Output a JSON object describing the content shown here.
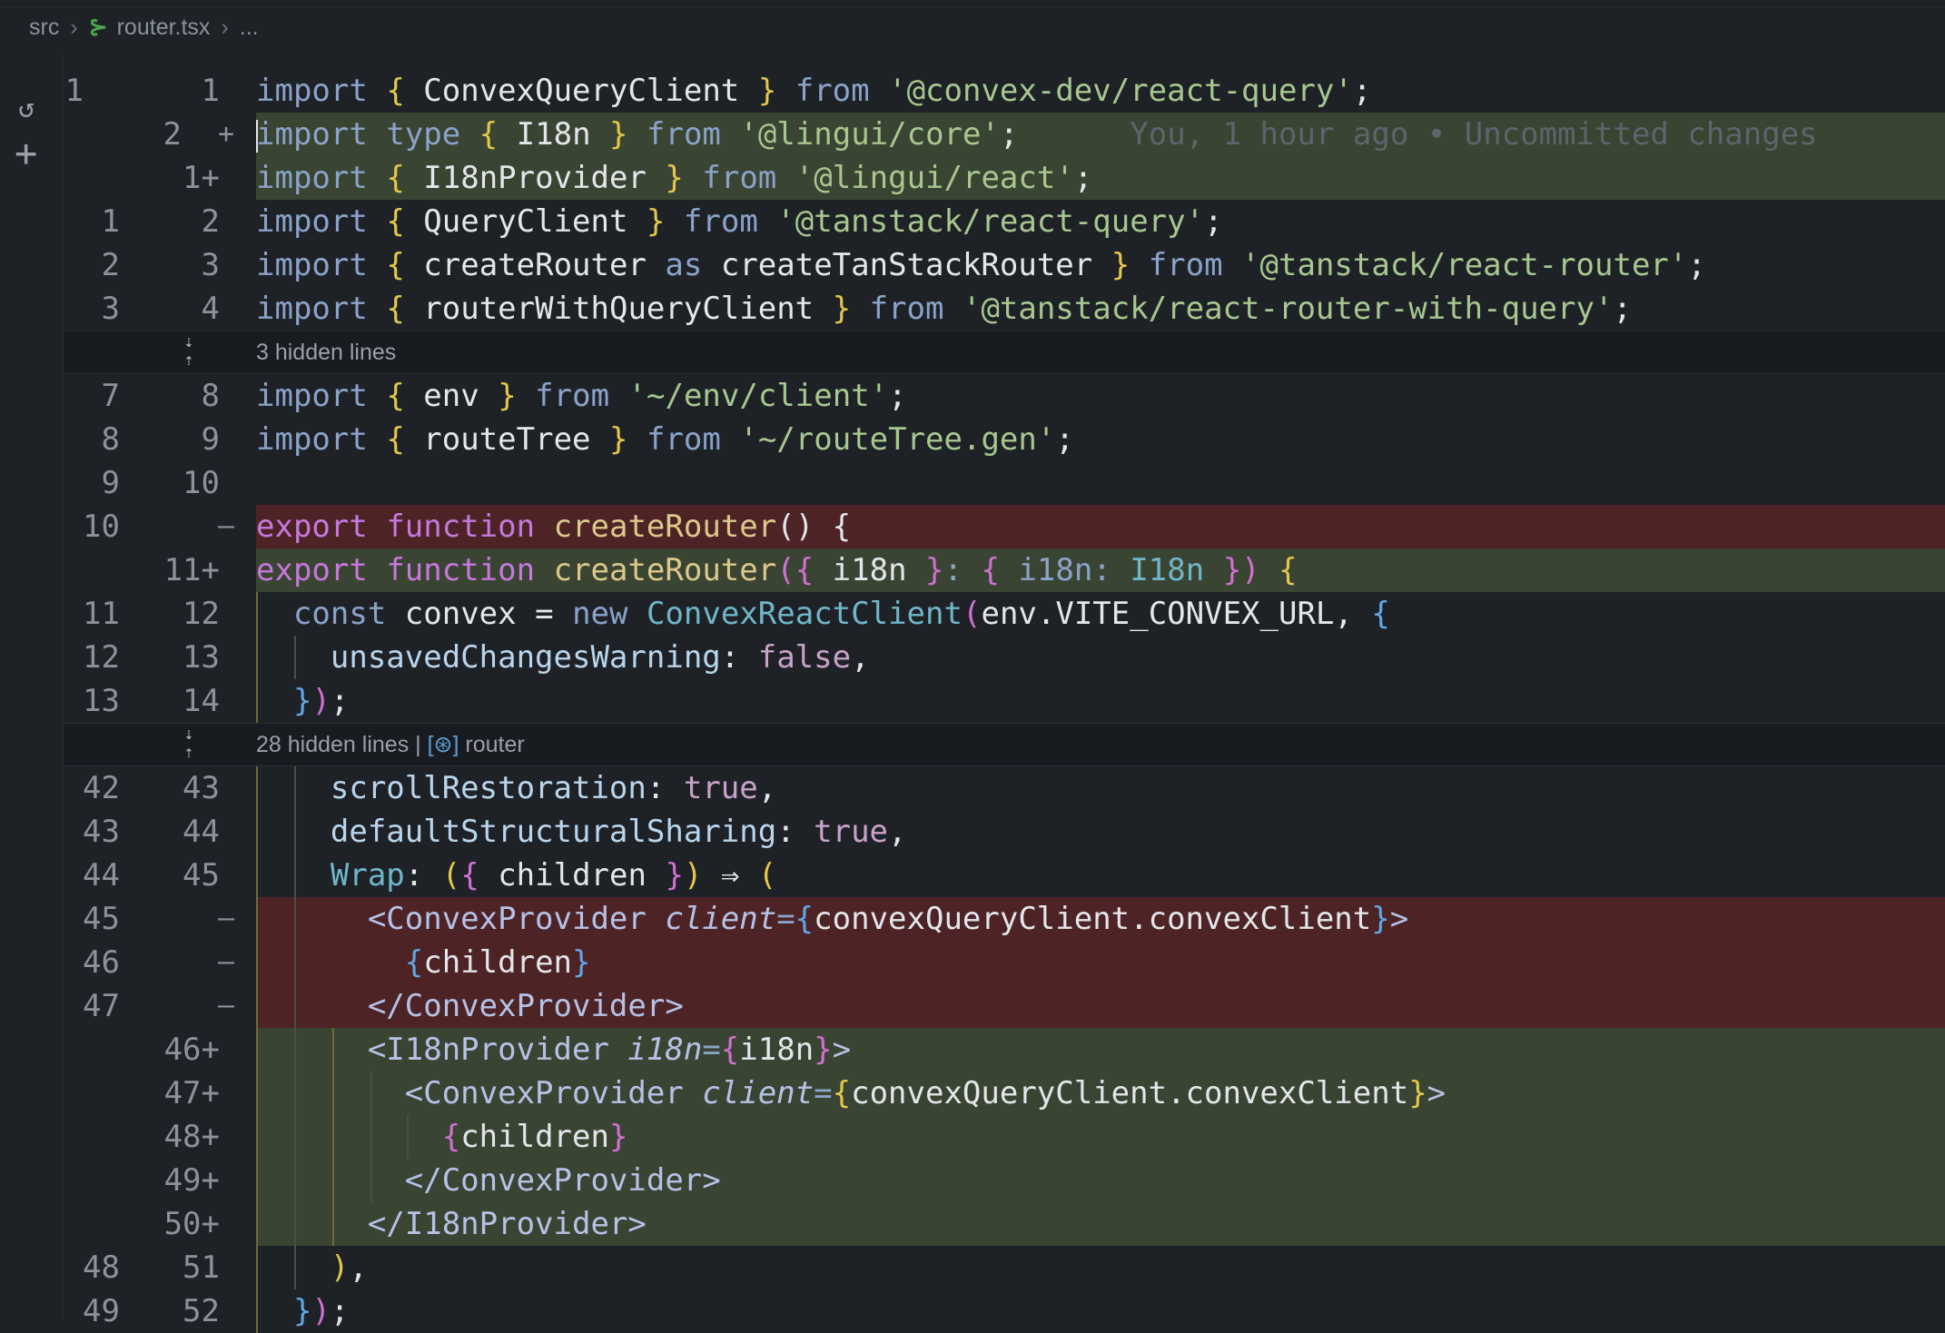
{
  "breadcrumb": {
    "folder": "src",
    "file": "router.tsx",
    "more": "..."
  },
  "hidden_1": {
    "label": "3 hidden lines"
  },
  "hidden_2": {
    "label": "28 hidden lines",
    "divider": "|",
    "symbol": "router"
  },
  "blame": "You, 1 hour ago • Uncommitted changes",
  "lines": [
    {
      "old": "1",
      "new": "1",
      "mark": ""
    },
    {
      "old": "",
      "new": "2",
      "mark": "+"
    },
    {
      "old": "",
      "new": "1+",
      "mark": ""
    },
    {
      "old": "1",
      "new": "2",
      "mark": ""
    },
    {
      "old": "2",
      "new": "3",
      "mark": ""
    },
    {
      "old": "3",
      "new": "4",
      "mark": ""
    },
    {
      "old": "7",
      "new": "8",
      "mark": ""
    },
    {
      "old": "8",
      "new": "9",
      "mark": ""
    },
    {
      "old": "9",
      "new": "10",
      "mark": ""
    },
    {
      "old": "10",
      "new": "",
      "mark": "–"
    },
    {
      "old": "",
      "new": "11+",
      "mark": ""
    },
    {
      "old": "11",
      "new": "12",
      "mark": ""
    },
    {
      "old": "12",
      "new": "13",
      "mark": ""
    },
    {
      "old": "13",
      "new": "14",
      "mark": ""
    },
    {
      "old": "42",
      "new": "43",
      "mark": ""
    },
    {
      "old": "43",
      "new": "44",
      "mark": ""
    },
    {
      "old": "44",
      "new": "45",
      "mark": ""
    },
    {
      "old": "45",
      "new": "",
      "mark": "–"
    },
    {
      "old": "46",
      "new": "",
      "mark": "–"
    },
    {
      "old": "47",
      "new": "",
      "mark": "–"
    },
    {
      "old": "",
      "new": "46+",
      "mark": ""
    },
    {
      "old": "",
      "new": "47+",
      "mark": ""
    },
    {
      "old": "",
      "new": "48+",
      "mark": ""
    },
    {
      "old": "",
      "new": "49+",
      "mark": ""
    },
    {
      "old": "",
      "new": "50+",
      "mark": ""
    },
    {
      "old": "48",
      "new": "51",
      "mark": ""
    },
    {
      "old": "49",
      "new": "52",
      "mark": ""
    }
  ],
  "tok": {
    "import": "import",
    "type": "type",
    "from": "from",
    "as": "as",
    "export": "export",
    "function": "function",
    "const": "const",
    "new": "new",
    "lb": "{",
    "rb": "}",
    "lp": "(",
    "rp": ")",
    "semi": ";",
    "comma": ",",
    "colon": ":",
    "arrow": "⇒",
    "ConvexQueryClient": "ConvexQueryClient",
    "I18n": "I18n",
    "I18nProvider": "I18nProvider",
    "QueryClient": "QueryClient",
    "createRouter": "createRouter",
    "createTanStackRouter": "createTanStackRouter",
    "routerWithQueryClient": "routerWithQueryClient",
    "env": "env",
    "routeTree": "routeTree",
    "i18n": "i18n",
    "convex": "convex",
    "ConvexReactClient": "ConvexReactClient",
    "envUrl": "env.VITE_CONVEX_URL",
    "unsavedChangesWarning": "unsavedChangesWarning",
    "false": "false",
    "true": "true",
    "scrollRestoration": "scrollRestoration",
    "defaultStructuralSharing": "defaultStructuralSharing",
    "Wrap": "Wrap",
    "children": "children",
    "s_convex_rq": "'@convex-dev/react-query'",
    "s_lingui_core": "'@lingui/core'",
    "s_lingui_react": "'@lingui/react'",
    "s_tanstack_rq": "'@tanstack/react-query'",
    "s_tanstack_router": "'@tanstack/react-router'",
    "s_tanstack_rwq": "'@tanstack/react-router-with-query'",
    "s_env_client": "'~/env/client'",
    "s_routeTree": "'~/routeTree.gen'",
    "open_ConvexProvider": "<ConvexProvider",
    "close_ConvexProvider": "</ConvexProvider>",
    "client_attr": "client",
    "eq": "=",
    "convexClientExpr": "convexQueryClient.convexClient",
    "gt": ">",
    "open_I18nProvider": "<I18nProvider",
    "close_I18nProvider": "</I18nProvider>",
    "i18n_attr": "i18n"
  }
}
